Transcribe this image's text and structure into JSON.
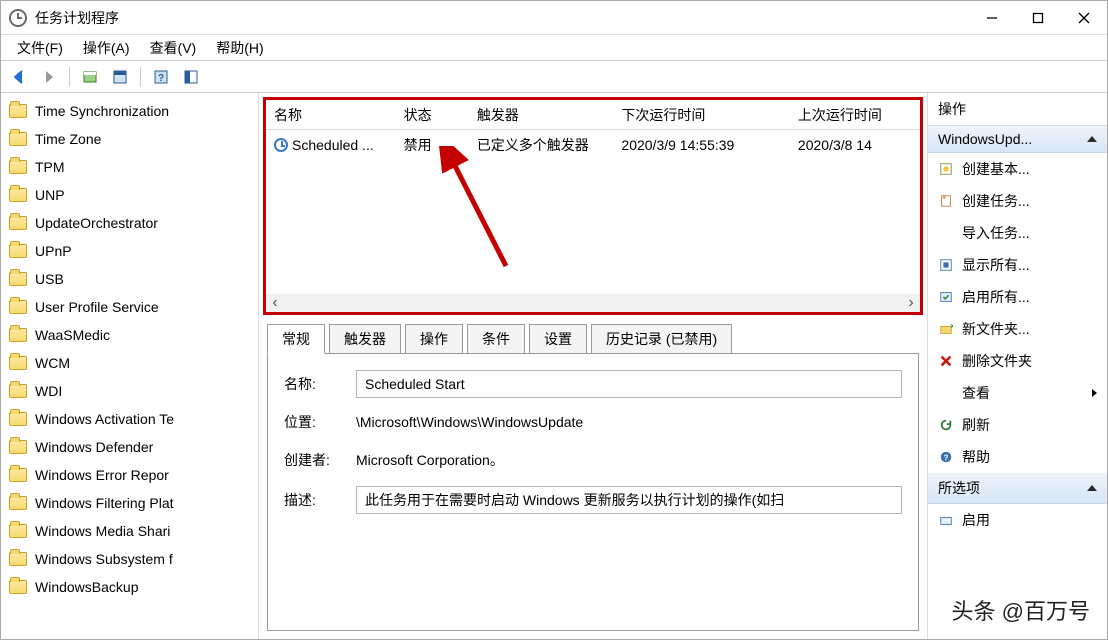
{
  "titlebar": {
    "title": "任务计划程序"
  },
  "menu": {
    "file": "文件(F)",
    "action": "操作(A)",
    "view": "查看(V)",
    "help": "帮助(H)"
  },
  "tree": [
    "Time Synchronization",
    "Time Zone",
    "TPM",
    "UNP",
    "UpdateOrchestrator",
    "UPnP",
    "USB",
    "User Profile Service",
    "WaaSMedic",
    "WCM",
    "WDI",
    "Windows Activation Te",
    "Windows Defender",
    "Windows Error Repor",
    "Windows Filtering Plat",
    "Windows Media Shari",
    "Windows Subsystem f",
    "WindowsBackup"
  ],
  "task_table": {
    "headers": [
      "名称",
      "状态",
      "触发器",
      "下次运行时间",
      "上次运行时间"
    ],
    "row": {
      "name": "Scheduled ...",
      "status": "禁用",
      "trigger": "已定义多个触发器",
      "next": "2020/3/9 14:55:39",
      "last": "2020/3/8 14"
    }
  },
  "tabs": {
    "general": "常规",
    "triggers": "触发器",
    "ops": "操作",
    "conditions": "条件",
    "settings": "设置",
    "history": "历史记录 (已禁用)"
  },
  "detail": {
    "name_label": "名称:",
    "name": "Scheduled Start",
    "loc_label": "位置:",
    "loc": "\\Microsoft\\Windows\\WindowsUpdate",
    "author_label": "创建者:",
    "author": "Microsoft Corporation。",
    "desc_label": "描述:",
    "desc": "此任务用于在需要时启动 Windows 更新服务以执行计划的操作(如扫"
  },
  "actions": {
    "title": "操作",
    "group1": "WindowsUpd...",
    "items1": [
      "创建基本...",
      "创建任务...",
      "导入任务...",
      "显示所有...",
      "启用所有...",
      "新文件夹...",
      "删除文件夹",
      "查看",
      "刷新",
      "帮助"
    ],
    "group2": "所选项",
    "items2": [
      "启用"
    ]
  },
  "brand": "头条 @百万号"
}
